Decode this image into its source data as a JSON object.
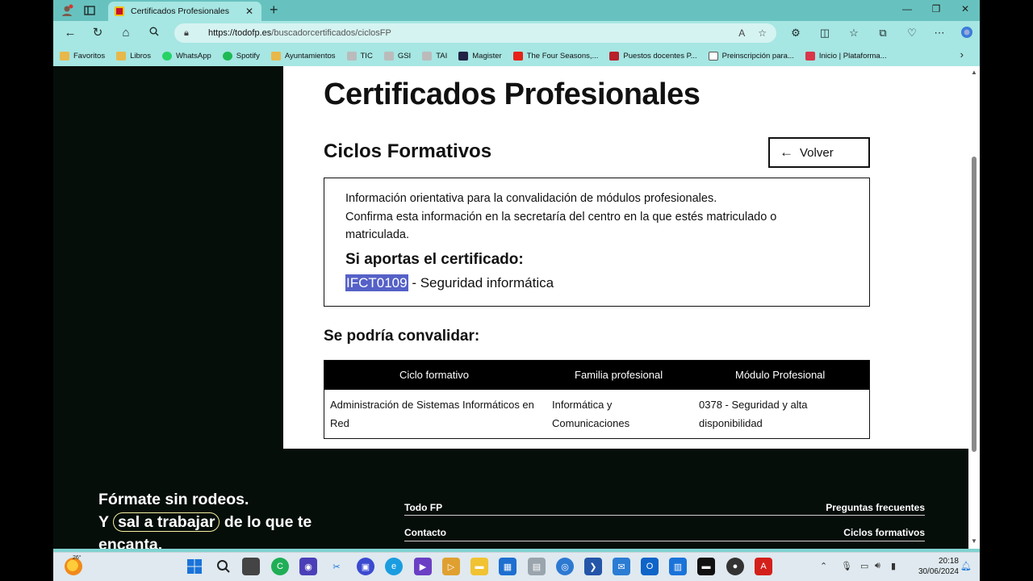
{
  "browser": {
    "tab_title": "Certificados Profesionales",
    "tab_close": "✕",
    "new_tab": "+",
    "url_host": "https://todofp.es",
    "url_path": "/buscadorcertificados/ciclosFP",
    "bookmarks": [
      {
        "label": "Favoritos",
        "color": "#e8b84a"
      },
      {
        "label": "Libros",
        "color": "#e8b84a"
      },
      {
        "label": "WhatsApp",
        "color": "#25d366"
      },
      {
        "label": "Spotify",
        "color": "#1db954"
      },
      {
        "label": "Ayuntamientos",
        "color": "#e8b84a"
      },
      {
        "label": "TIC",
        "color": "#bbbbbb"
      },
      {
        "label": "GSI",
        "color": "#bbbbbb"
      },
      {
        "label": "TAI",
        "color": "#bbbbbb"
      },
      {
        "label": "Magister",
        "color": "#222244"
      },
      {
        "label": "The Four Seasons,...",
        "color": "#e62117"
      },
      {
        "label": "Puestos docentes P...",
        "color": "#b8202a"
      },
      {
        "label": "Preinscripción para...",
        "color": "#ffffff"
      },
      {
        "label": "Inicio | Plataforma...",
        "color": "#d9364a"
      }
    ]
  },
  "page": {
    "title": "Certificados Profesionales",
    "subtitle": "Ciclos Formativos",
    "back_button": "Volver",
    "info_line1": "Información orientativa para la convalidación de módulos profesionales.",
    "info_line2": "Confirma esta información en la secretaría del centro en la que estés matriculado o",
    "info_line3": "matriculada.",
    "cert_heading": "Si aportas el certificado:",
    "cert_code": "IFCT0109",
    "cert_name": " - Seguridad informática",
    "convalidar_heading": "Se podría convalidar:",
    "table": {
      "headers": [
        "Ciclo formativo",
        "Familia profesional",
        "Módulo Profesional"
      ],
      "rows": [
        {
          "ciclo_1": "Administración de Sistemas Informáticos en",
          "ciclo_2": "Red",
          "familia_1": "Informática y",
          "familia_2": "Comunicaciones",
          "modulo_1": "0378 - Seguridad y alta",
          "modulo_2": "disponibilidad"
        }
      ]
    }
  },
  "footer": {
    "slogan_line1": "Fórmate sin rodeos.",
    "slogan_y": "Y",
    "slogan_highlight": "sal a trabajar",
    "slogan_rest": "de lo que te",
    "slogan_line3": "encanta.",
    "link_todofp": "Todo FP",
    "link_preguntas": "Preguntas frecuentes",
    "link_contacto": "Contacto",
    "link_ciclos": "Ciclos formativos"
  },
  "taskbar": {
    "temperature": "26°",
    "time": "20:18",
    "date": "30/06/2024"
  }
}
